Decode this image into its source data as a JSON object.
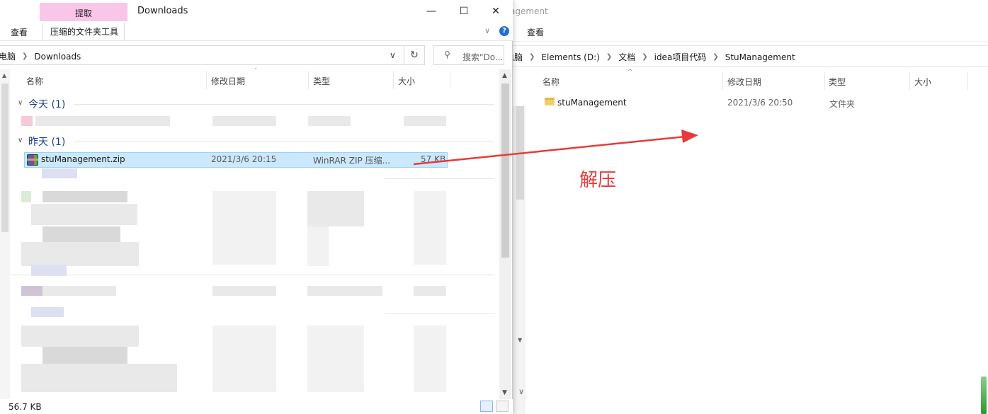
{
  "left_window": {
    "tool_tab": "提取",
    "title": "Downloads",
    "controls": {
      "minimize": "—",
      "maximize": "☐",
      "close": "✕"
    },
    "menu": {
      "view": "查看",
      "tools": "压缩的文件夹工具"
    },
    "help": "?",
    "breadcrumb": [
      "电脑",
      "Downloads"
    ],
    "search_placeholder": "搜索\"Do...",
    "columns": {
      "name": "名称",
      "modified": "修改日期",
      "type": "类型",
      "size": "大小"
    },
    "groups": {
      "today": "今天 (1)",
      "yesterday": "昨天 (1)"
    },
    "selected_file": {
      "name": "stuManagement.zip",
      "modified": "2021/3/6 20:15",
      "type": "WinRAR ZIP 压缩...",
      "size": "57 KB"
    },
    "status": "56.7 KB"
  },
  "right_window": {
    "title_fragment": "agement",
    "menu": {
      "view": "查看"
    },
    "breadcrumb": [
      "电脑",
      "Elements (D:)",
      "文档",
      "idea项目代码",
      "StuManagement"
    ],
    "columns": {
      "name": "名称",
      "modified": "修改日期",
      "type": "类型",
      "size": "大小"
    },
    "folder": {
      "name": "stuManagement",
      "modified": "2021/3/6 20:50",
      "type": "文件夹"
    }
  },
  "annotation": {
    "label": "解压",
    "color": "#e83a3a"
  },
  "colors": {
    "selection_bg": "#cce8ff",
    "selection_border": "#99d1ff",
    "tool_tab": "#f9c6ea",
    "group_header": "#1e3c8c",
    "accent_blue": "#1f6fd0"
  }
}
